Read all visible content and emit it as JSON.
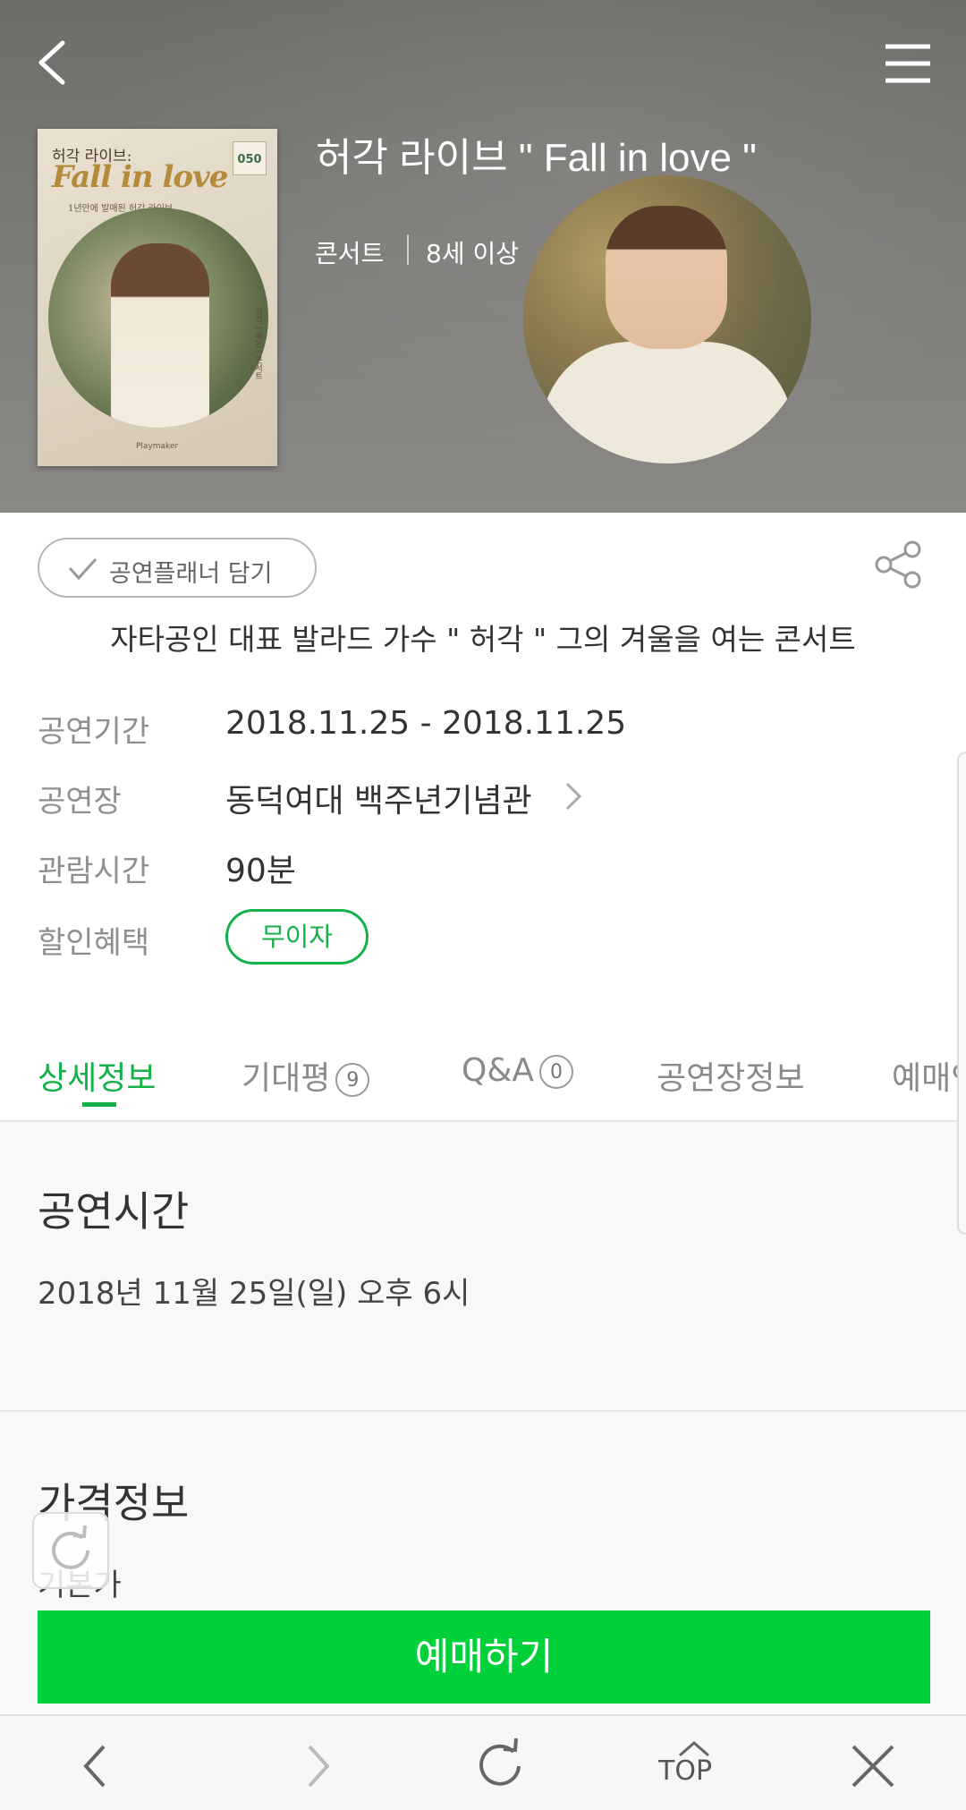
{
  "header": {
    "back_icon": "chevron-left-icon",
    "menu_icon": "hamburger-menu-icon"
  },
  "poster": {
    "title_small": "허각 라이브:",
    "title_big": "Fall in love",
    "subtitle": "1년만에 발매된 허각 라이브",
    "number": "050",
    "vertical_text": "허각 | 에는 | 콘서트",
    "logo": "Playmaker"
  },
  "show": {
    "title": "허각 라이브 \" Fall in love \"",
    "genre": "콘서트",
    "age": "8세 이상"
  },
  "actions": {
    "planner_label": "공연플래너 담기",
    "share_icon": "share-icon"
  },
  "tagline": "자타공인 대표 발라드 가수 \" 허각 \" 그의 겨울을 여는 콘서트",
  "info": {
    "period_label": "공연기간",
    "period_value": "2018.11.25 - 2018.11.25",
    "venue_label": "공연장",
    "venue_value": "동덕여대 백주년기념관",
    "runtime_label": "관람시간",
    "runtime_value": "90분",
    "discount_label": "할인혜택",
    "discount_value": "무이자"
  },
  "tabs": [
    {
      "label": "상세정보",
      "active": true
    },
    {
      "label": "기대평",
      "count": "9"
    },
    {
      "label": "Q&A",
      "count": "0"
    },
    {
      "label": "공연장정보"
    },
    {
      "label": "예매안내"
    }
  ],
  "detail": {
    "time_title": "공연시간",
    "time_text": "2018년 11월 25일(일) 오후 6시",
    "price_title": "가격정보",
    "price_sub": "기본가"
  },
  "book_button": "예매하기",
  "bottom_nav": {
    "back": "arrow-left-icon",
    "forward": "arrow-right-icon",
    "refresh": "refresh-icon",
    "top_label": "TOP",
    "close": "close-icon"
  },
  "colors": {
    "accent_green": "#14b04a",
    "book_green": "#00d03a",
    "hero_gray": "#7d7b78"
  }
}
